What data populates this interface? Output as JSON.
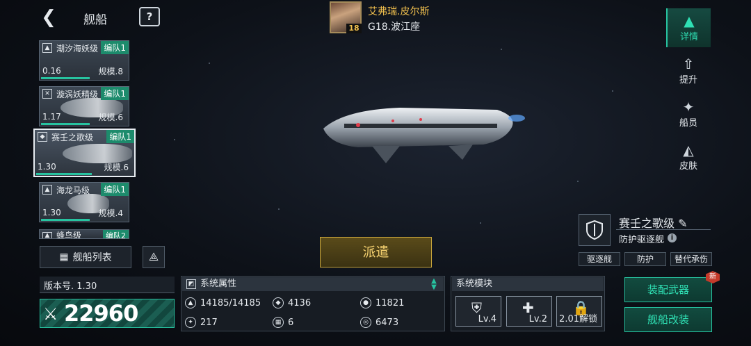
{
  "header": {
    "back_glyph": "❮",
    "title": "舰船",
    "help_glyph": "?"
  },
  "commander": {
    "name": "艾弗瑞.皮尔斯",
    "level": "18",
    "location": "G18.波江座"
  },
  "ship_list": [
    {
      "icon": "shark",
      "class_name": "潮汐海妖级",
      "fleet": "编队1",
      "value": "0.16",
      "scale": "规模.8"
    },
    {
      "icon": "vortex",
      "class_name": "漩涡妖精级",
      "fleet": "编队1",
      "value": "1.17",
      "scale": "规模.6"
    },
    {
      "icon": "shield",
      "class_name": "赛壬之歌级",
      "fleet": "编队1",
      "value": "1.30",
      "scale": "规模.6"
    },
    {
      "icon": "shark",
      "class_name": "海龙马级",
      "fleet": "编队1",
      "value": "1.30",
      "scale": "规模.4"
    },
    {
      "icon": "shark",
      "class_name": "蜂鸟级",
      "fleet": "编队2",
      "value": "",
      "scale": ""
    }
  ],
  "ship_list_button": "舰船列表",
  "version_label": "版本号. 1.30",
  "power_value": "22960",
  "attributes": {
    "title": "系统属性",
    "items": [
      {
        "icon": "hp-icon",
        "value": "14185/14185"
      },
      {
        "icon": "attack-icon",
        "value": "4136"
      },
      {
        "icon": "defense-icon",
        "value": "11821"
      },
      {
        "icon": "speed-icon",
        "value": "217"
      },
      {
        "icon": "grid-icon",
        "value": "6"
      },
      {
        "icon": "target-icon",
        "value": "6473"
      }
    ]
  },
  "modules": {
    "title": "系统模块",
    "slots": [
      {
        "icon": "shield-icon",
        "label": "Lv.4"
      },
      {
        "icon": "repair-icon",
        "label": "Lv.2"
      },
      {
        "icon": "lock-icon",
        "label": "2.01解锁"
      }
    ]
  },
  "dispatch_button": "派遣",
  "ship_info": {
    "name": "赛壬之歌级",
    "type": "防护驱逐舰",
    "tags": [
      "驱逐舰",
      "防护",
      "替代承伤"
    ]
  },
  "actions": {
    "equip": "装配武器",
    "modify": "舰船改装",
    "new_badge": "新"
  },
  "nav": [
    {
      "icon": "details-icon",
      "label": "详情"
    },
    {
      "icon": "upgrade-icon",
      "label": "提升"
    },
    {
      "icon": "crew-icon",
      "label": "船员"
    },
    {
      "icon": "skin-icon",
      "label": "皮肤"
    }
  ],
  "colors": {
    "accent": "#27c3a0",
    "gold": "#f2c14e",
    "badge": "#c53a2a"
  }
}
